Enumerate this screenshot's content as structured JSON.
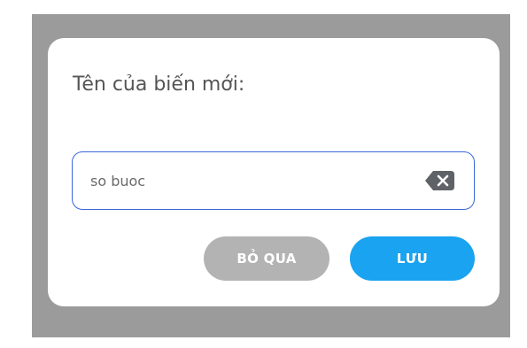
{
  "dialog": {
    "title": "Tên của biến mới:",
    "input": {
      "value": "so buoc",
      "clear_icon": "backspace-clear-icon"
    },
    "buttons": {
      "skip_label": "BỎ QUA",
      "save_label": "LƯU"
    }
  },
  "colors": {
    "overlay": "#9b9b9b",
    "dialog_bg": "#ffffff",
    "input_border": "#3a66d9",
    "skip_button": "#b3b3b3",
    "save_button": "#19a3f0"
  }
}
